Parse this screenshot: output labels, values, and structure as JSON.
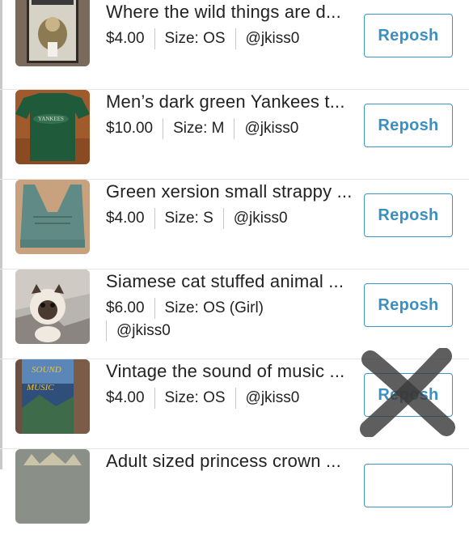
{
  "listings": [
    {
      "title": "Where the wild things are d...",
      "price": "$4.00",
      "size": "Size: OS",
      "seller": "@jkiss0",
      "action": "Reposh",
      "thumb": "dvd-wild-things"
    },
    {
      "title": "Men’s dark green Yankees t...",
      "price": "$10.00",
      "size": "Size: M",
      "seller": "@jkiss0",
      "action": "Reposh",
      "thumb": "green-yankees-tshirt"
    },
    {
      "title": "Green xersion small strappy ...",
      "price": "$4.00",
      "size": "Size: S",
      "seller": "@jkiss0",
      "action": "Reposh",
      "thumb": "green-sports-bra"
    },
    {
      "title": "Siamese cat stuffed animal ...",
      "price": "$6.00",
      "size": "Size: OS (Girl)",
      "seller": "@jkiss0",
      "action": "Reposh",
      "thumb": "siamese-cat-plush"
    },
    {
      "title": "Vintage the sound of music ...",
      "price": "$4.00",
      "size": "Size: OS",
      "seller": "@jkiss0",
      "action": "Reposh",
      "thumb": "sound-of-music-vhs"
    },
    {
      "title": "Adult sized princess crown ...",
      "price": "",
      "size": "",
      "seller": "",
      "action": "",
      "thumb": "princess-crown"
    }
  ],
  "overlay": {
    "icon": "x-mark-icon"
  },
  "colors": {
    "accent": "#3a8fc3",
    "separator": "#c8c8c8",
    "text": "#222222"
  }
}
